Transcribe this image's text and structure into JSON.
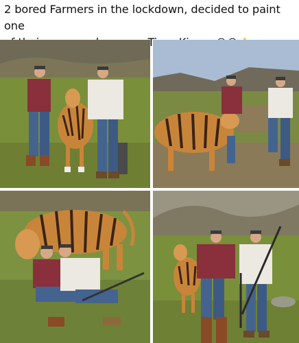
{
  "post": {
    "caption_line1": "2 bored Farmers in the lockdown, decided to paint one",
    "caption_line2": "of their cows and pose as Tiger Kings.",
    "caption_emojis": "😂😂👍"
  },
  "photos": [
    {
      "scene": "field-standing-with-cow",
      "icon": "tiger-painted-cow"
    },
    {
      "scene": "yard-standing-behind-cow",
      "icon": "tiger-painted-cow"
    },
    {
      "scene": "field-sitting-with-cow",
      "icon": "tiger-painted-cow"
    },
    {
      "scene": "field-with-calf-and-guns",
      "icon": "tiger-painted-calf"
    }
  ],
  "colors": {
    "grass": "#7a8f3a",
    "sky": "#a9bcd3",
    "tiger_orange": "#c8853a",
    "maroon_shirt": "#8a2f3c",
    "white_shirt": "#ece8e2",
    "denim": "#44648f"
  }
}
